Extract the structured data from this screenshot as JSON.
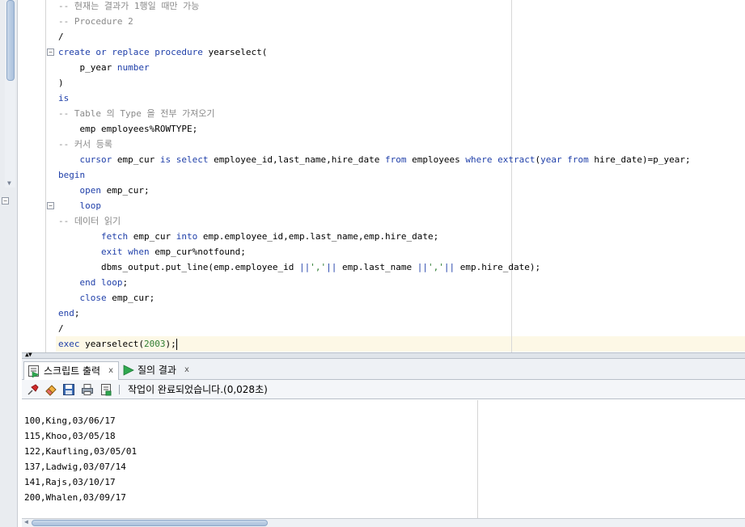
{
  "editor": {
    "lines": [
      {
        "segments": [
          {
            "t": "-- 현재는 결과가 1행일 때만 가능",
            "c": "cm"
          }
        ]
      },
      {
        "segments": [
          {
            "t": "-- Procedure 2",
            "c": "cm"
          }
        ]
      },
      {
        "segments": [
          {
            "t": "/",
            "c": ""
          }
        ]
      },
      {
        "segments": [
          {
            "t": "create",
            "c": "kw"
          },
          {
            "t": " ",
            "c": ""
          },
          {
            "t": "or",
            "c": "kw"
          },
          {
            "t": " ",
            "c": ""
          },
          {
            "t": "replace",
            "c": "kw"
          },
          {
            "t": " ",
            "c": ""
          },
          {
            "t": "procedure",
            "c": "kw"
          },
          {
            "t": " yearselect(",
            "c": ""
          }
        ]
      },
      {
        "segments": [
          {
            "t": "    p_year ",
            "c": ""
          },
          {
            "t": "number",
            "c": "kw"
          }
        ]
      },
      {
        "segments": [
          {
            "t": ")",
            "c": ""
          }
        ]
      },
      {
        "segments": [
          {
            "t": "is",
            "c": "kw"
          }
        ]
      },
      {
        "segments": [
          {
            "t": "-- Table 의 Type 을 전부 가져오기",
            "c": "cm"
          }
        ]
      },
      {
        "segments": [
          {
            "t": "    emp employees%ROWTYPE;",
            "c": ""
          }
        ]
      },
      {
        "segments": [
          {
            "t": "-- 커서 등록",
            "c": "cm"
          }
        ]
      },
      {
        "segments": [
          {
            "t": "    ",
            "c": ""
          },
          {
            "t": "cursor",
            "c": "kw"
          },
          {
            "t": " emp_cur ",
            "c": ""
          },
          {
            "t": "is",
            "c": "kw"
          },
          {
            "t": " ",
            "c": ""
          },
          {
            "t": "select",
            "c": "kw"
          },
          {
            "t": " employee_id,last_name,hire_date ",
            "c": ""
          },
          {
            "t": "from",
            "c": "kw"
          },
          {
            "t": " employees ",
            "c": ""
          },
          {
            "t": "where",
            "c": "kw"
          },
          {
            "t": " ",
            "c": ""
          },
          {
            "t": "extract",
            "c": "kw"
          },
          {
            "t": "(",
            "c": ""
          },
          {
            "t": "year",
            "c": "kw"
          },
          {
            "t": " ",
            "c": ""
          },
          {
            "t": "from",
            "c": "kw"
          },
          {
            "t": " hire_date)=p_year;",
            "c": ""
          }
        ]
      },
      {
        "segments": [
          {
            "t": "begin",
            "c": "kw"
          }
        ]
      },
      {
        "segments": [
          {
            "t": "    ",
            "c": ""
          },
          {
            "t": "open",
            "c": "kw"
          },
          {
            "t": " emp_cur;",
            "c": ""
          }
        ]
      },
      {
        "segments": [
          {
            "t": "    ",
            "c": ""
          },
          {
            "t": "loop",
            "c": "kw"
          }
        ]
      },
      {
        "segments": [
          {
            "t": "-- 데이터 읽기",
            "c": "cm"
          }
        ]
      },
      {
        "segments": [
          {
            "t": "        ",
            "c": ""
          },
          {
            "t": "fetch",
            "c": "kw"
          },
          {
            "t": " emp_cur ",
            "c": ""
          },
          {
            "t": "into",
            "c": "kw"
          },
          {
            "t": " emp.employee_id,emp.last_name,emp.hire_date;",
            "c": ""
          }
        ]
      },
      {
        "segments": [
          {
            "t": "        ",
            "c": ""
          },
          {
            "t": "exit",
            "c": "kw"
          },
          {
            "t": " ",
            "c": ""
          },
          {
            "t": "when",
            "c": "kw"
          },
          {
            "t": " emp_cur%notfound;",
            "c": ""
          }
        ]
      },
      {
        "segments": [
          {
            "t": "        dbms_output.put_line(emp.employee_id ",
            "c": ""
          },
          {
            "t": "||",
            "c": "kw"
          },
          {
            "t": "','",
            "c": "st"
          },
          {
            "t": "||",
            "c": "kw"
          },
          {
            "t": " emp.last_name ",
            "c": ""
          },
          {
            "t": "||",
            "c": "kw"
          },
          {
            "t": "','",
            "c": "st"
          },
          {
            "t": "||",
            "c": "kw"
          },
          {
            "t": " emp.hire_date);",
            "c": ""
          }
        ]
      },
      {
        "segments": [
          {
            "t": "    ",
            "c": ""
          },
          {
            "t": "end",
            "c": "kw"
          },
          {
            "t": " ",
            "c": ""
          },
          {
            "t": "loop",
            "c": "kw"
          },
          {
            "t": ";",
            "c": ""
          }
        ]
      },
      {
        "segments": [
          {
            "t": "    ",
            "c": ""
          },
          {
            "t": "close",
            "c": "kw"
          },
          {
            "t": " emp_cur;",
            "c": ""
          }
        ]
      },
      {
        "segments": [
          {
            "t": "end",
            "c": "kw"
          },
          {
            "t": ";",
            "c": ""
          }
        ]
      },
      {
        "segments": [
          {
            "t": "/",
            "c": ""
          }
        ]
      },
      {
        "segments": [
          {
            "t": "exec",
            "c": "kw"
          },
          {
            "t": " yearselect(",
            "c": ""
          },
          {
            "t": "2003",
            "c": "st"
          },
          {
            "t": ");",
            "c": ""
          }
        ]
      }
    ],
    "fold_markers": [
      3,
      13
    ]
  },
  "tabs": [
    {
      "label": "스크립트 출력",
      "close": "x",
      "icon": "script-output-icon"
    },
    {
      "label": "질의 결과",
      "close": "x",
      "icon": "run-query-icon"
    }
  ],
  "toolbar": {
    "status": "작업이 완료되었습니다.(0,028초)",
    "buttons": [
      "pin-icon",
      "eraser-icon",
      "save-icon",
      "print-icon",
      "export-icon"
    ]
  },
  "output": {
    "lines": [
      "100,King,03/06/17",
      "115,Khoo,03/05/18",
      "122,Kaufling,03/05/01",
      "137,Ladwig,03/07/14",
      "141,Rajs,03/10/17",
      "200,Whalen,03/09/17"
    ]
  },
  "colors": {
    "keyword": "#1f3fa9",
    "comment": "#8a8a8a",
    "literal": "#2e7d32",
    "current_line": "#fdf8e6"
  }
}
